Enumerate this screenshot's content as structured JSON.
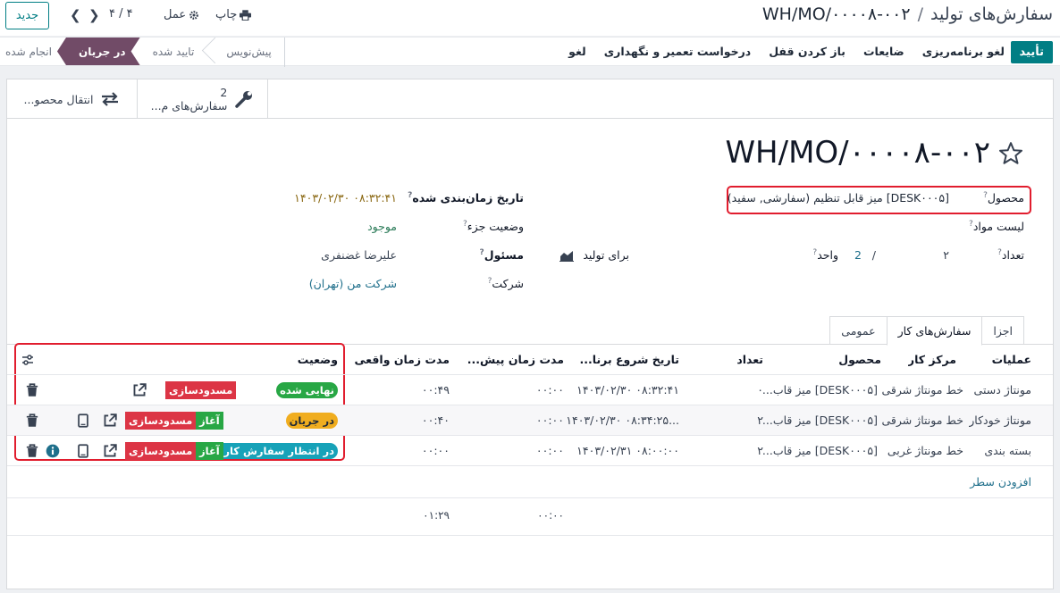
{
  "topbar": {
    "new_label": "جدید",
    "pager": "۴ / ۴",
    "action_label": "عمل",
    "print_label": "چاپ",
    "breadcrumb_parent": "سفارش‌های تولید",
    "breadcrumb_sep": "/",
    "breadcrumb_current": "WH/MO/۰۰۰۰۸-۰۰۲"
  },
  "actionbar": {
    "confirm_label": "تأیید",
    "buttons": [
      "لغو برنامه‌ریزی",
      "ضایعات",
      "باز کردن قفل",
      "درخواست تعمیر و نگهداری",
      "لغو"
    ],
    "stages": [
      "پیش‌نویس",
      "تایید شده",
      "در جریان",
      "انجام شده"
    ],
    "active_stage": "در جریان"
  },
  "smart_buttons": {
    "work_orders_count": "2",
    "work_orders_label": "سفارش‌های م...",
    "transfers_label": "انتقال محصو..."
  },
  "record": {
    "title": "WH/MO/۰۰۰۰۸-۰۰۲",
    "product_label": "محصول",
    "product_value": "[DESK۰۰۰۵] میز قابل تنظیم (سفارشی, سفید)",
    "bom_label": "لیست مواد",
    "quantity_label": "تعداد",
    "quantity_value": "۲",
    "quantity_sep": "/",
    "quantity_produced": "2",
    "unit_label": "واحد",
    "to_produce_label": "برای تولید",
    "scheduled_label": "تاریخ زمان‌بندی شده",
    "scheduled_value": "۱۴۰۳/۰۲/۳۰ ۰۸:۳۲:۴۱",
    "component_status_label": "وضعیت جزء",
    "component_status_value": "موجود",
    "responsible_label": "مسئول",
    "responsible_value": "علیرضا غضنفری",
    "company_label": "شرکت",
    "company_value": "شرکت من (تهران)",
    "help_mark": "?"
  },
  "tabs": [
    "اجزا",
    "سفارش‌های کار",
    "عمومی"
  ],
  "active_tab": "سفارش‌های کار",
  "table": {
    "headers": {
      "operation": "عملیات",
      "workcenter": "مرکز کار",
      "product": "محصول",
      "quantity": "تعداد",
      "start": "تاریخ شروع برنا...",
      "expected": "مدت زمان پیش...",
      "real": "مدت زمان واقعی",
      "status": "وضعیت"
    },
    "rows": [
      {
        "operation": "مونتاژ دستی",
        "workcenter": "خط مونتاژ شرقی",
        "product": "[DESK۰۰۰۵] میز قاب...",
        "quantity": "۰",
        "start": "۱۴۰۳/۰۲/۳۰ ۰۸:۳۲:۴۱",
        "expected": "۰۰:۰۰",
        "real": "۰۰:۴۹",
        "status": "نهایی شده",
        "block_label": "مسدودسازی"
      },
      {
        "operation": "مونتاژ خودکار",
        "workcenter": "خط مونتاژ شرقی",
        "product": "[DESK۰۰۰۵] میز قاب...",
        "quantity": "۲",
        "start": "۱۴۰۳/۰۲/۳۰ ۰۸:۳۴:۲۵...",
        "expected": "۰۰:۰۰",
        "real": "۰۰:۴۰",
        "status": "در جریان",
        "block_label": "مسدودسازی",
        "start_label": "آغاز"
      },
      {
        "operation": "بسته بندی",
        "workcenter": "خط مونتاژ غربی",
        "product": "[DESK۰۰۰۵] میز قاب...",
        "quantity": "۲",
        "start": "۱۴۰۳/۰۲/۳۱ ۰۸:۰۰:۰۰",
        "expected": "۰۰:۰۰",
        "real": "۰۰:۰۰",
        "status": "در انتظار سفارش کار ...",
        "block_label": "مسدودسازی",
        "start_label": "آغاز"
      }
    ],
    "add_line": "افزودن سطر",
    "total_expected": "۰۰:۰۰",
    "total_real": "۰۱:۲۹"
  },
  "colors": {
    "primary": "#017e84",
    "active_stage": "#714b67",
    "highlight_box": "#e11d2e",
    "done_badge": "#28a745",
    "progress_badge": "#f0ad1f",
    "waiting_badge": "#17a2b8",
    "block_button": "#dc3545"
  }
}
